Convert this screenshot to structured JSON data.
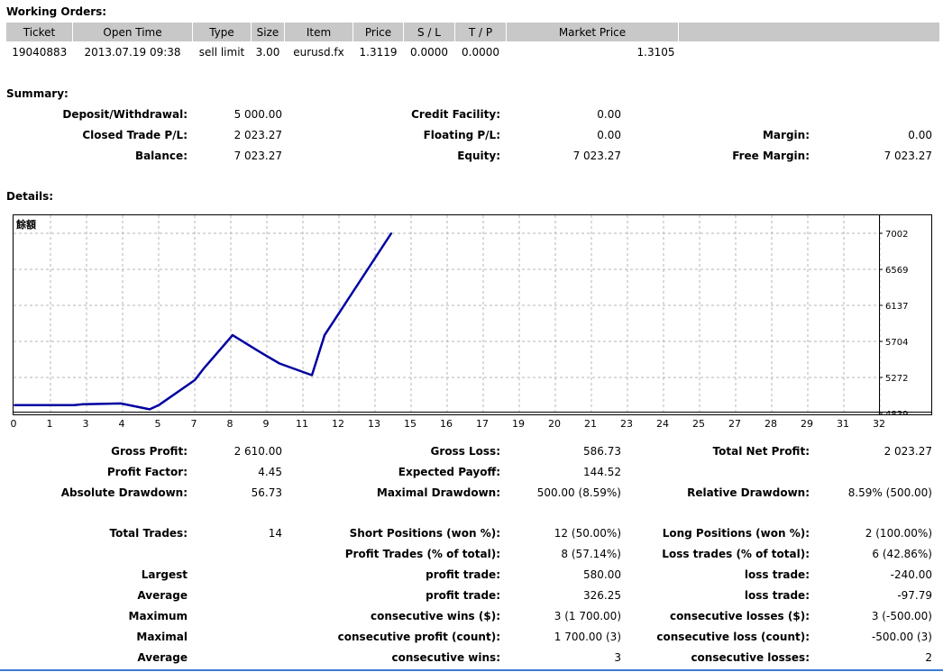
{
  "working_orders": {
    "title": "Working Orders:",
    "columns": [
      "Ticket",
      "Open Time",
      "Type",
      "Size",
      "Item",
      "Price",
      "S / L",
      "T / P",
      "Market Price",
      ""
    ],
    "rows": [
      [
        "19040883",
        "2013.07.19 09:38",
        "sell limit",
        "3.00",
        "eurusd.fx",
        "1.3119",
        "0.0000",
        "0.0000",
        "1.3105",
        ""
      ]
    ]
  },
  "summary": {
    "title": "Summary:",
    "deposit_label": "Deposit/Withdrawal:",
    "deposit_value": "5 000.00",
    "credit_label": "Credit Facility:",
    "credit_value": "0.00",
    "closed_label": "Closed Trade P/L:",
    "closed_value": "2 023.27",
    "floating_label": "Floating P/L:",
    "floating_value": "0.00",
    "margin_label": "Margin:",
    "margin_value": "0.00",
    "balance_label": "Balance:",
    "balance_value": "7 023.27",
    "equity_label": "Equity:",
    "equity_value": "7 023.27",
    "free_margin_label": "Free Margin:",
    "free_margin_value": "7 023.27"
  },
  "details": {
    "title": "Details:",
    "rows": [
      {
        "l1": "Gross Profit:",
        "v1": "2 610.00",
        "l2": "Gross Loss:",
        "v2": "586.73",
        "l3": "Total Net Profit:",
        "v3": "2 023.27"
      },
      {
        "l1": "Profit Factor:",
        "v1": "4.45",
        "l2": "Expected Payoff:",
        "v2": "144.52",
        "l3": "",
        "v3": ""
      },
      {
        "l1": "Absolute Drawdown:",
        "v1": "56.73",
        "l2": "Maximal Drawdown:",
        "v2": "500.00 (8.59%)",
        "l3": "Relative Drawdown:",
        "v3": "8.59% (500.00)"
      },
      {
        "l1": "Total Trades:",
        "v1": "14",
        "l2": "Short Positions (won %):",
        "v2": "12 (50.00%)",
        "l3": "Long Positions (won %):",
        "v3": "2 (100.00%)"
      },
      {
        "l1": "",
        "v1": "",
        "l2": "Profit Trades (% of total):",
        "v2": "8 (57.14%)",
        "l3": "Loss trades (% of total):",
        "v3": "6 (42.86%)"
      },
      {
        "l1": "Largest",
        "v1": "",
        "l2": "profit trade:",
        "v2": "580.00",
        "l3": "loss trade:",
        "v3": "-240.00"
      },
      {
        "l1": "Average",
        "v1": "",
        "l2": "profit trade:",
        "v2": "326.25",
        "l3": "loss trade:",
        "v3": "-97.79"
      },
      {
        "l1": "Maximum",
        "v1": "",
        "l2": "consecutive wins ($):",
        "v2": "3 (1 700.00)",
        "l3": "consecutive losses ($):",
        "v3": "3 (-500.00)"
      },
      {
        "l1": "Maximal",
        "v1": "",
        "l2": "consecutive profit (count):",
        "v2": "1 700.00 (3)",
        "l3": "consecutive loss (count):",
        "v3": "-500.00 (3)"
      },
      {
        "l1": "Average",
        "v1": "",
        "l2": "consecutive wins:",
        "v2": "3",
        "l3": "consecutive losses:",
        "v3": "2"
      }
    ]
  },
  "chart_data": {
    "type": "line",
    "legend_label": "餘額",
    "x_tick_labels": [
      "0",
      "1",
      "3",
      "4",
      "5",
      "7",
      "8",
      "9",
      "11",
      "12",
      "13",
      "15",
      "16",
      "17",
      "19",
      "20",
      "21",
      "23",
      "24",
      "25",
      "27",
      "28",
      "29",
      "31",
      "32"
    ],
    "y_tick_labels": [
      "7002",
      "6569",
      "6137",
      "5704",
      "5272",
      "4839"
    ],
    "ylim": [
      4839,
      7002
    ],
    "grid": true,
    "line_color": "#0000a0",
    "series": [
      {
        "x": [
          0,
          1.65,
          1.9,
          2.95,
          3.75,
          4.0,
          5.0,
          5.25,
          6.05,
          6.8,
          7.35,
          8.25,
          8.6,
          10.45
        ],
        "y": [
          4939,
          4939,
          4949,
          4959,
          4889,
          4939,
          5239,
          5379,
          5779,
          5579,
          5439,
          5299,
          5779,
          7002
        ]
      }
    ]
  }
}
